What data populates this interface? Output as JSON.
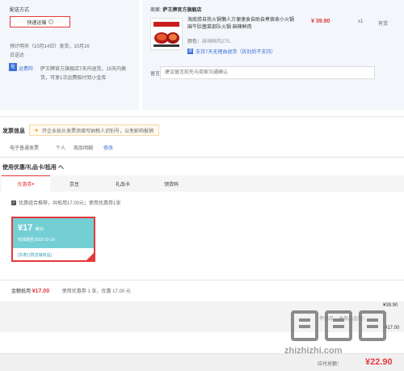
{
  "shipping": {
    "section_label": "配送方式",
    "method_button": "快递运输",
    "delivery_time": "预计明天（10月14日）发货，10月16",
    "delivery_time_2": "日送达",
    "shop_badge": "运费险",
    "shop_note": "萨王牌官方旗舰店7天内退货，15天内换",
    "shop_note_2": "货，可享1次运费赔付到小金库"
  },
  "shop": {
    "prefix": "商家:",
    "name": "萨王牌官方旗舰店"
  },
  "product": {
    "title": "海底捞自热火锅懒人方便速食自助自煮宿舍小火锅麻牛肚菌菜部队火锅 麻辣鲜肉",
    "price": "¥ 39.90",
    "quantity": "x1",
    "stock": "有货",
    "attr_label": "颜色：",
    "attr_value": "麻辣鲜肉275...",
    "service_icon": "退",
    "service": "支持7天无理由退货（拆封后不支持）"
  },
  "memo": {
    "label": "留言:",
    "placeholder": "建议留言前先与商家沟通确认"
  },
  "invoice": {
    "title": "发票信息",
    "tip": "开企业抬头发票须填写纳税人识别号，以免影响报销",
    "type": "电子普通发票",
    "personal": "个人",
    "detail": "商品明细",
    "edit": "修改"
  },
  "coupons": {
    "title": "使用优惠/礼品卡/抵用 へ",
    "tabs": [
      "优惠券",
      "京豆",
      "礼品卡",
      "领货码"
    ],
    "active_mark": "●",
    "option_text": "优惠组合推荐，共抵用17.00元；使用优惠券1张",
    "coupon_amount": "¥17",
    "coupon_condition": "满39",
    "coupon_expiry": "有效期至2023-10-19",
    "coupon_desc": "[东券] [限店铺商品]",
    "total_label": "金额抵用",
    "total_amount": "¥17.00",
    "total_info": "使用优惠券 1 张，优惠 17.00 元"
  },
  "summary": {
    "label": "件商品，总商品金额：",
    "val1": "¥39.90",
    "val2": "-¥17.00",
    "pay_label": "应付总额：",
    "pay_amount": "¥22.90"
  },
  "watermark": {
    "text": "zhizhizhi.com"
  }
}
